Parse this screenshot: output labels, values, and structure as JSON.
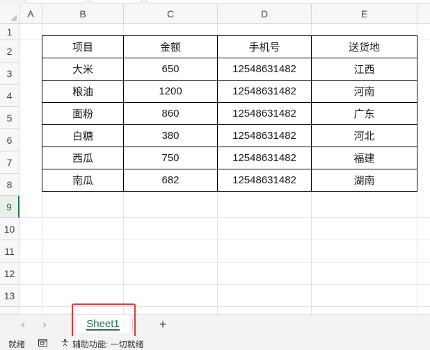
{
  "columns": [
    "A",
    "B",
    "C",
    "D",
    "E"
  ],
  "rows": [
    "1",
    "2",
    "3",
    "4",
    "5",
    "6",
    "7",
    "8",
    "9",
    "10",
    "11",
    "12",
    "13"
  ],
  "table": {
    "headers": [
      "项目",
      "金额",
      "手机号",
      "送货地"
    ],
    "rows": [
      [
        "大米",
        "650",
        "12548631482",
        "江西"
      ],
      [
        "粮油",
        "1200",
        "12548631482",
        "河南"
      ],
      [
        "面粉",
        "860",
        "12548631482",
        "广东"
      ],
      [
        "白糖",
        "380",
        "12548631482",
        "河北"
      ],
      [
        "西瓜",
        "750",
        "12548631482",
        "福建"
      ],
      [
        "南瓜",
        "682",
        "12548631482",
        "湖南"
      ]
    ]
  },
  "active_row": "9",
  "sheet_tabs": {
    "active": "Sheet1",
    "add_label": "+"
  },
  "status": {
    "ready": "就绪",
    "accessibility": "辅助功能: 一切就绪"
  },
  "colors": {
    "accent": "#217346",
    "highlight": "#e0393e"
  }
}
